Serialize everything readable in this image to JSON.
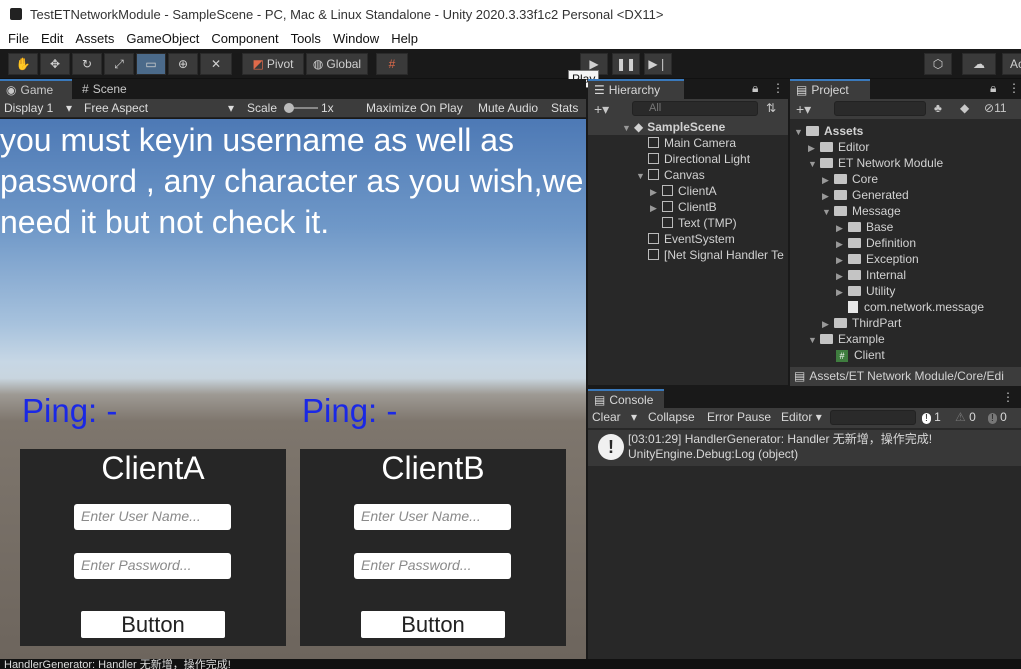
{
  "window": {
    "title": "TestETNetworkModule - SampleScene - PC, Mac & Linux Standalone - Unity 2020.3.33f1c2 Personal <DX11>"
  },
  "menu": [
    "File",
    "Edit",
    "Assets",
    "GameObject",
    "Component",
    "Tools",
    "Window",
    "Help"
  ],
  "toolbar": {
    "pivot": "Pivot",
    "global": "Global",
    "tooltip": "Play",
    "account": "Ac"
  },
  "game_panel": {
    "tabs": [
      "Game",
      "Scene"
    ],
    "display": "Display 1",
    "aspect": "Free Aspect",
    "scale_label": "Scale",
    "scale_value": "1x",
    "maximize": "Maximize On Play",
    "mute": "Mute Audio",
    "stats": "Stats"
  },
  "game_view": {
    "instruction": "you must keyin username as well as password , any character as you wish,we need it but not check it.",
    "clients": [
      {
        "ping": "Ping: -",
        "title": "ClientA",
        "username_placeholder": "Enter User Name...",
        "password_placeholder": "Enter Password...",
        "button": "Button"
      },
      {
        "ping": "Ping: -",
        "title": "ClientB",
        "username_placeholder": "Enter User Name...",
        "password_placeholder": "Enter Password...",
        "button": "Button"
      }
    ]
  },
  "hierarchy": {
    "title": "Hierarchy",
    "search_placeholder": "All",
    "items": [
      "SampleScene",
      "Main Camera",
      "Directional Light",
      "Canvas",
      "ClientA",
      "ClientB",
      "Text (TMP)",
      "EventSystem",
      "[Net Signal Handler Te"
    ]
  },
  "project": {
    "title": "Project",
    "hidden_count": "11",
    "items": [
      "Assets",
      "Editor",
      "ET Network Module",
      "Core",
      "Generated",
      "Message",
      "Base",
      "Definition",
      "Exception",
      "Internal",
      "Utility",
      "com.network.message",
      "ThirdPart",
      "Example",
      "Client"
    ],
    "path": "Assets/ET Network Module/Core/Edi"
  },
  "console": {
    "title": "Console",
    "buttons": [
      "Clear",
      "Collapse",
      "Error Pause",
      "Editor"
    ],
    "counts": {
      "log": "1",
      "warn": "0",
      "error": "0"
    },
    "entry_line1": "[03:01:29] HandlerGenerator: Handler 无新增，操作完成!",
    "entry_line2": "UnityEngine.Debug:Log (object)"
  },
  "status_bar": "HandlerGenerator: Handler 无新增，操作完成!"
}
